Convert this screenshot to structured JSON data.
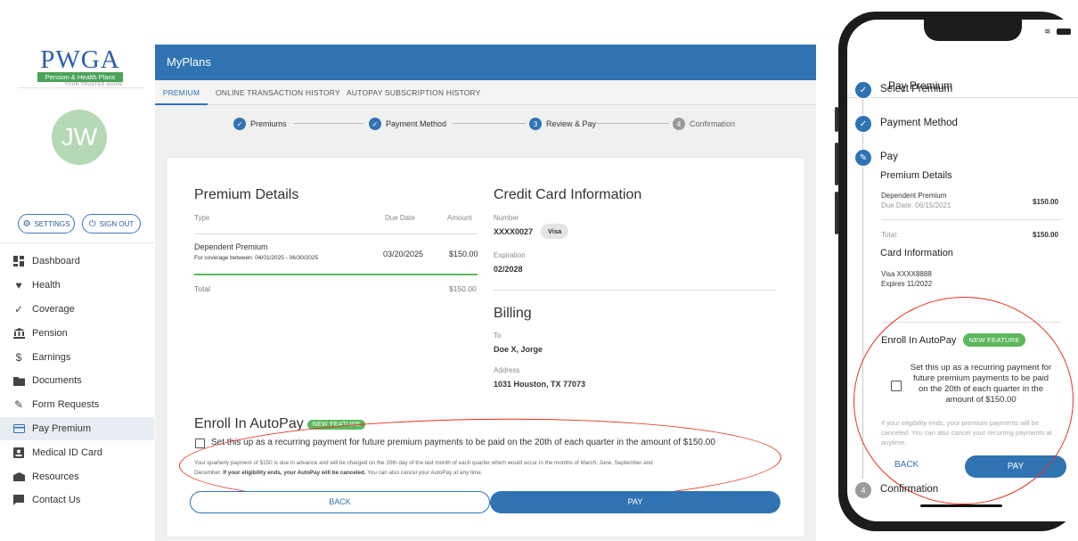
{
  "logo": {
    "name": "PWGA",
    "subtitle": "Pension & Health Plans",
    "tagline": "YOUR TRUSTED GUIDE"
  },
  "user": {
    "initials": "JW"
  },
  "sidebar_buttons": {
    "settings": "SETTINGS",
    "signout": "SIGN OUT"
  },
  "nav": [
    {
      "label": "Dashboard",
      "icon": "dashboard-icon"
    },
    {
      "label": "Health",
      "icon": "heart-icon"
    },
    {
      "label": "Coverage",
      "icon": "check-icon"
    },
    {
      "label": "Pension",
      "icon": "bank-icon"
    },
    {
      "label": "Earnings",
      "icon": "dollar-icon"
    },
    {
      "label": "Documents",
      "icon": "folder-icon"
    },
    {
      "label": "Form Requests",
      "icon": "pencil-icon"
    },
    {
      "label": "Pay Premium",
      "icon": "credit-card-icon",
      "active": true
    },
    {
      "label": "Medical ID Card",
      "icon": "id-card-icon"
    },
    {
      "label": "Resources",
      "icon": "box-icon"
    },
    {
      "label": "Contact Us",
      "icon": "chat-icon"
    }
  ],
  "topbar": {
    "title": "MyPlans"
  },
  "tabs": [
    "PREMIUM",
    "ONLINE TRANSACTION HISTORY",
    "AUTOPAY SUBSCRIPTION HISTORY"
  ],
  "steps": [
    {
      "label": "Premiums",
      "state": "done"
    },
    {
      "label": "Payment Method",
      "state": "done"
    },
    {
      "num": "3",
      "label": "Review & Pay",
      "state": "current"
    },
    {
      "num": "4",
      "label": "Confirmation",
      "state": "pending"
    }
  ],
  "premium": {
    "heading": "Premium Details",
    "col_type": "Type",
    "col_due": "Due Date",
    "col_amount": "Amount",
    "row_name": "Dependent Premium",
    "row_coverage": "For coverage between: 04/01/2025 - 06/30/2025",
    "row_due": "03/20/2025",
    "row_amount": "$150.00",
    "total_label": "Total",
    "total_amount": "$150.00"
  },
  "card": {
    "heading": "Credit Card Information",
    "number_label": "Number",
    "number": "XXXX0027",
    "brand": "Visa",
    "exp_label": "Expiration",
    "exp": "02/2028"
  },
  "billing": {
    "heading": "Billing",
    "to_label": "To",
    "to": "Doe X, Jorge",
    "addr_label": "Address",
    "addr": "1031 Houston, TX 77073"
  },
  "autopay": {
    "heading": "Enroll In AutoPay",
    "badge": "NEW FEATURE",
    "checkbox_text": "Set this up as a recurring payment for future premium payments to be paid on the 20th of each quarter in the amount of $150.00",
    "note_a": "Your quarterly payment of $150 is due in advance and will be charged on the 20th day of the last month of each quarter which would occur in the months of March, June, September and",
    "note_b": "December.",
    "note_bold": "If your eligibility ends, your AutoPay will be canceled.",
    "note_c": "You can also cancel your AutoPay at any time."
  },
  "buttons": {
    "back": "BACK",
    "pay": "PAY"
  },
  "phone": {
    "nav_title": "Pay Premium",
    "step1": "Select Premium",
    "step2": "Payment Method",
    "step3": "Pay",
    "premium_heading": "Premium Details",
    "item": "Dependent Premium",
    "item_due": "Due Date: 06/15/2021",
    "item_amount": "$150.00",
    "total_label": "Total:",
    "total_amount": "$150.00",
    "card_heading": "Card Information",
    "card_line1": "Visa XXXX8888",
    "card_line2": "Expires 11/2022",
    "autopay_heading": "Enroll In AutoPay",
    "badge": "NEW FEATURE",
    "checkbox_text": "Set this up as a recurring payment for future premium payments to be paid on the 20th of each quarter in the amount of $150.00",
    "note": "If your eligibility ends, your premium payments will be canceled. You can also cancel your recurring payments at anytime.",
    "back": "BACK",
    "pay": "PAY",
    "step4_num": "4",
    "step4": "Confirmation"
  }
}
